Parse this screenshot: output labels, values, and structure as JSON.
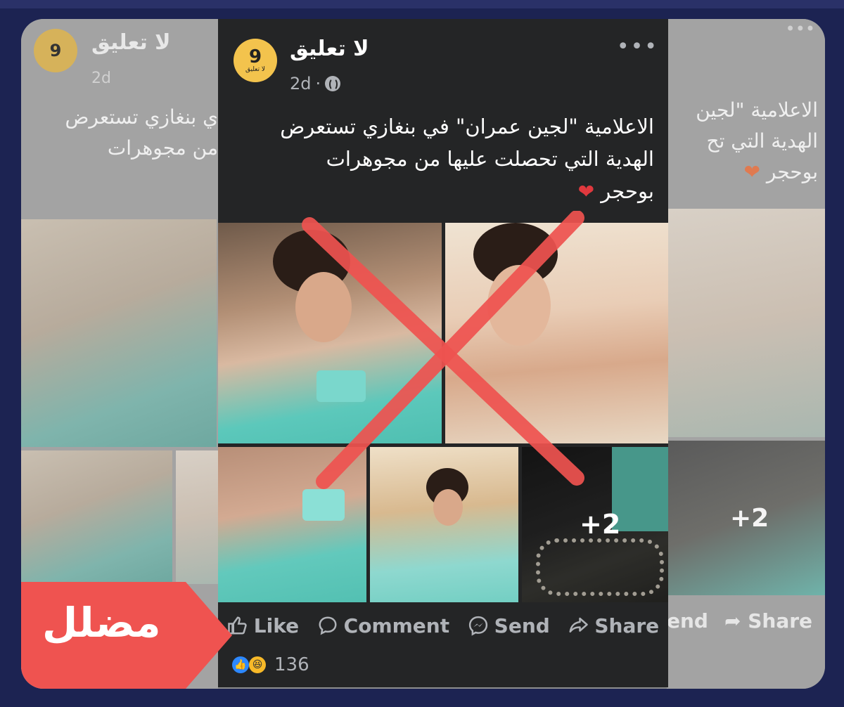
{
  "page": {
    "name": "لا تعليق",
    "avatar_text": "لا تعليق",
    "avatar_number": "9"
  },
  "post": {
    "time": "2d",
    "caption_lines": [
      "الاعلامية \"لجين عمران\" في بنغازي تستعرض",
      "الهدية التي تحصلت عليها من مجوهرات",
      "بوحجر"
    ],
    "heart": "❤",
    "more": "•••",
    "more_photos": "+2",
    "actions": {
      "like": "Like",
      "comment": "Comment",
      "send": "Send",
      "share": "Share"
    },
    "reaction_count": "136"
  },
  "ghost_left": {
    "name": "لا تعليق",
    "time": "2d",
    "text_lines": [
      "ي بنغازي تستعرض",
      "من مجوهرات"
    ],
    "more_photos": ""
  },
  "ghost_right": {
    "more": "•••",
    "text_lines": [
      "الاعلامية \"لجين",
      "الهدية التي تح",
      "بوحجر"
    ],
    "more_photos": "+2",
    "actions": {
      "send_partial": "end",
      "share": "Share"
    }
  },
  "badge": {
    "label": "مضلل",
    "color": "#ef5350"
  },
  "colors": {
    "post_bg": "#242526",
    "frame_bg": "#8e8e8e",
    "page_bg": "#1c2352",
    "cross": "#ef5350"
  }
}
